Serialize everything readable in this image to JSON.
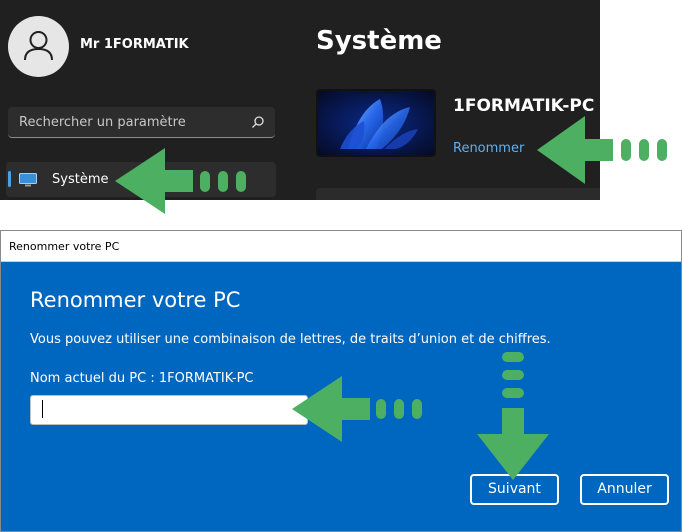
{
  "settings": {
    "user_name": "Mr 1FORMATIK",
    "search_placeholder": "Rechercher un paramètre",
    "nav_item_label": "Système",
    "page_title": "Système",
    "pc_name": "1FORMATIK-PC",
    "rename_link": "Renommer"
  },
  "dialog": {
    "window_title": "Renommer votre PC",
    "heading": "Renommer votre PC",
    "description": "Vous pouvez utiliser une combinaison de lettres, de traits d’union et de chiffres.",
    "current_name_label": "Nom actuel du PC : 1FORMATIK-PC",
    "input_value": "",
    "next_button": "Suivant",
    "cancel_button": "Annuler"
  },
  "colors": {
    "settings_bg": "#202020",
    "dialog_bg": "#0067c0",
    "accent_link": "#60b0f0",
    "annotation_arrow": "#4caf62"
  },
  "icons": [
    "avatar-person-icon",
    "search-icon",
    "monitor-icon",
    "windows-wallpaper-thumbnail"
  ]
}
